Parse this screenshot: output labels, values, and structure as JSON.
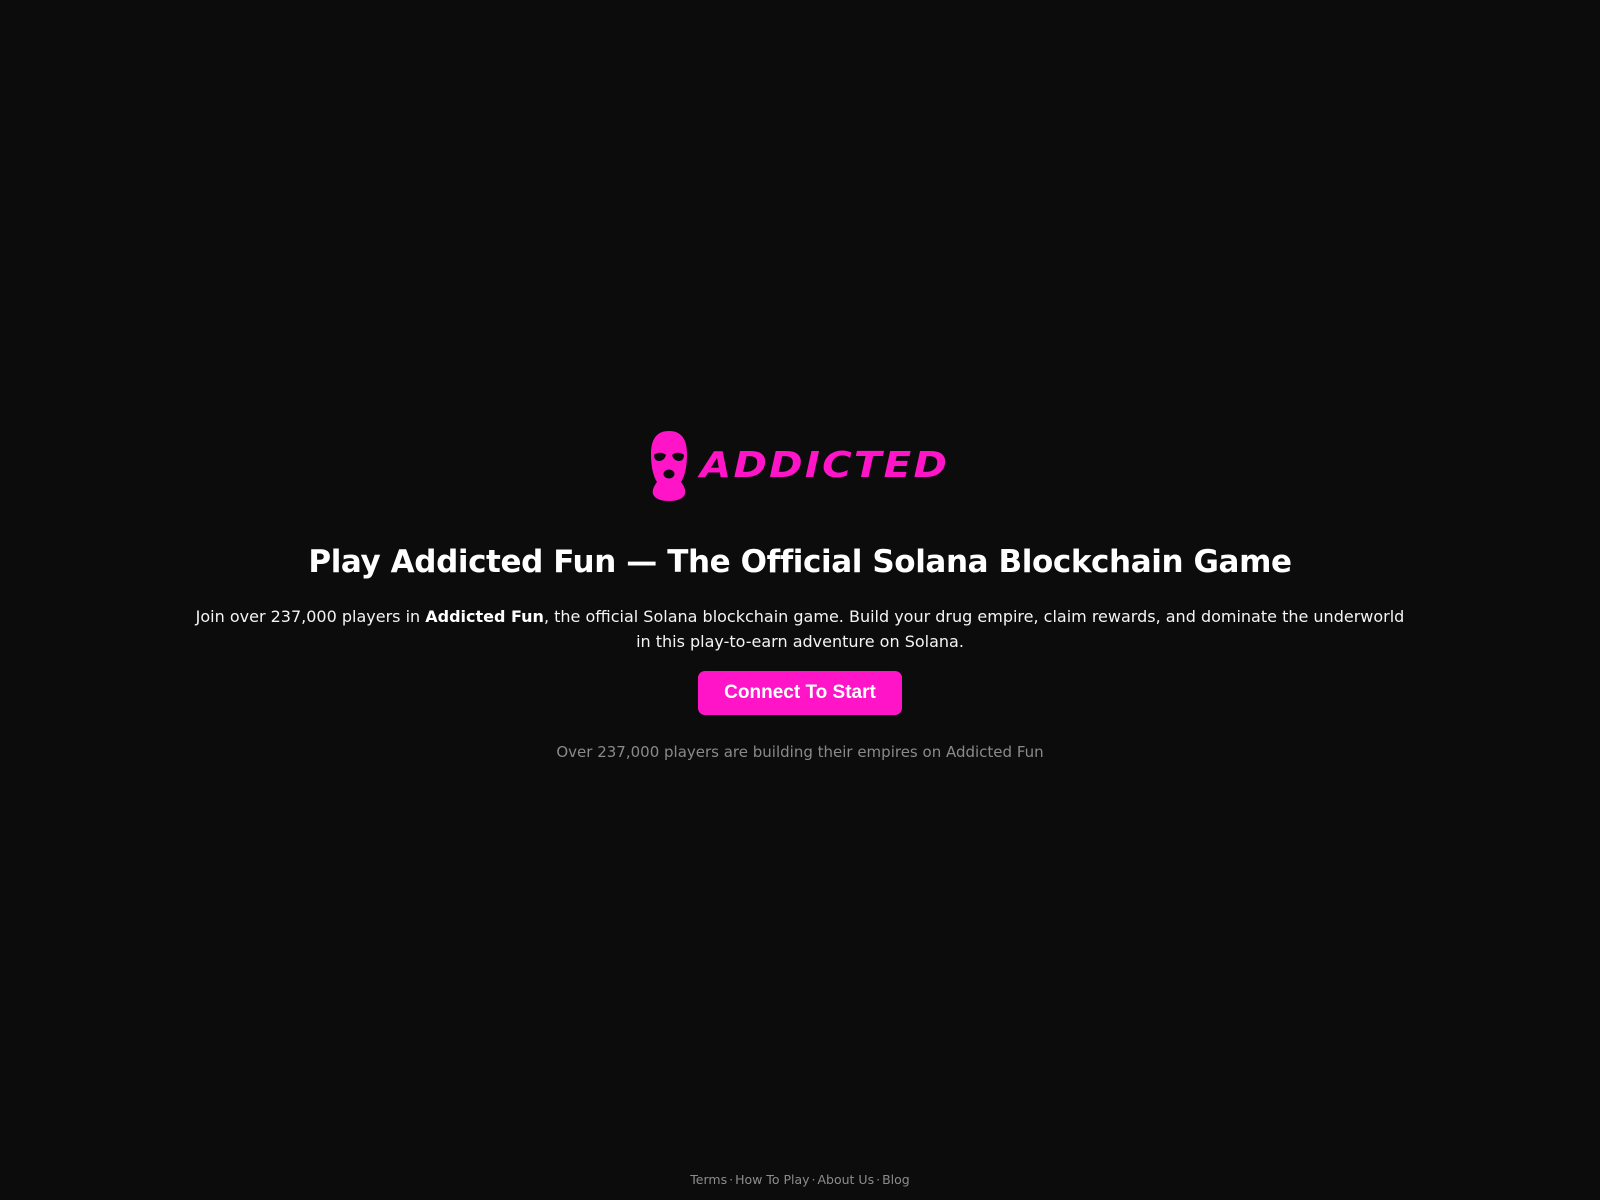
{
  "brand": {
    "wordmark": "ADDICTED",
    "accent_color": "#ff14c8",
    "icon": "balaclava-mask-icon"
  },
  "hero": {
    "title": "Play Addicted Fun — The Official Solana Blockchain Game",
    "description_before": "Join over 237,000 players in ",
    "description_bold": "Addicted Fun",
    "description_after": ", the official Solana blockchain game. Build your drug empire, claim rewards, and dominate the underworld in this play-to-earn adventure on Solana.",
    "cta_label": "Connect To Start",
    "players_note": "Over 237,000 players are building their empires on Addicted Fun"
  },
  "footer": {
    "links": [
      "Terms",
      "How To Play",
      "About Us",
      "Blog"
    ],
    "separator": "·"
  },
  "colors": {
    "background": "#0c0c0c",
    "text": "#ffffff",
    "muted": "#8a8a8a"
  }
}
